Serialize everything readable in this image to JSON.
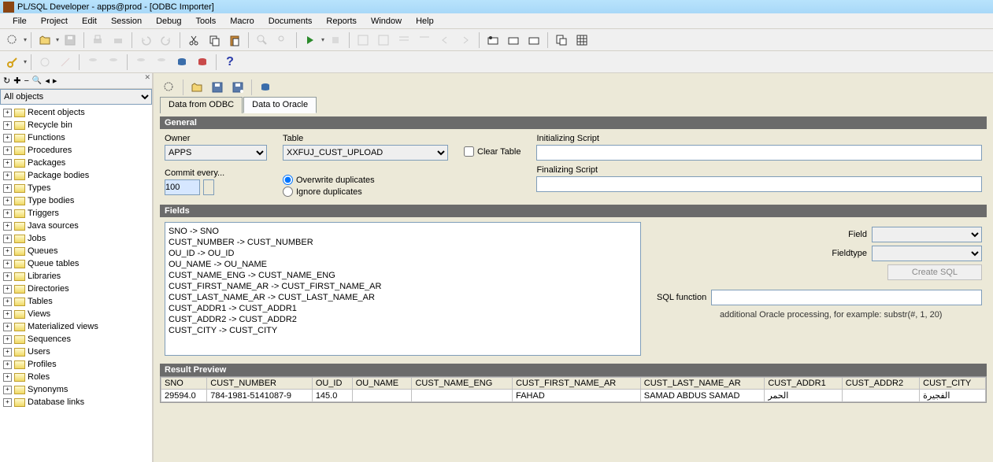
{
  "title": "PL/SQL Developer - apps@prod - [ODBC Importer]",
  "menu": [
    "File",
    "Project",
    "Edit",
    "Session",
    "Debug",
    "Tools",
    "Macro",
    "Documents",
    "Reports",
    "Window",
    "Help"
  ],
  "sidebar": {
    "filter": "All objects",
    "items": [
      "Recent objects",
      "Recycle bin",
      "Functions",
      "Procedures",
      "Packages",
      "Package bodies",
      "Types",
      "Type bodies",
      "Triggers",
      "Java sources",
      "Jobs",
      "Queues",
      "Queue tables",
      "Libraries",
      "Directories",
      "Tables",
      "Views",
      "Materialized views",
      "Sequences",
      "Users",
      "Profiles",
      "Roles",
      "Synonyms",
      "Database links"
    ]
  },
  "tabs": {
    "odbc": "Data from ODBC",
    "oracle": "Data to Oracle"
  },
  "sections": {
    "general": "General",
    "fields": "Fields",
    "preview": "Result Preview"
  },
  "general": {
    "owner_label": "Owner",
    "owner_value": "APPS",
    "table_label": "Table",
    "table_value": "XXFUJ_CUST_UPLOAD",
    "clear_table_label": "Clear Table",
    "commit_label": "Commit every...",
    "commit_value": "100",
    "overwrite_label": "Overwrite duplicates",
    "ignore_label": "Ignore duplicates",
    "init_script_label": "Initializing Script",
    "final_script_label": "Finalizing Script"
  },
  "fields": {
    "mappings": [
      "SNO -> SNO",
      "CUST_NUMBER -> CUST_NUMBER",
      "OU_ID -> OU_ID",
      "OU_NAME -> OU_NAME",
      "CUST_NAME_ENG -> CUST_NAME_ENG",
      "CUST_FIRST_NAME_AR -> CUST_FIRST_NAME_AR",
      "CUST_LAST_NAME_AR -> CUST_LAST_NAME_AR",
      "CUST_ADDR1 -> CUST_ADDR1",
      "CUST_ADDR2 -> CUST_ADDR2",
      "CUST_CITY -> CUST_CITY"
    ],
    "field_label": "Field",
    "fieldtype_label": "Fieldtype",
    "create_sql_label": "Create SQL",
    "sql_function_label": "SQL function",
    "hint": "additional Oracle processing, for example: substr(#, 1, 20)"
  },
  "preview": {
    "headers": [
      "SNO",
      "CUST_NUMBER",
      "OU_ID",
      "OU_NAME",
      "CUST_NAME_ENG",
      "CUST_FIRST_NAME_AR",
      "CUST_LAST_NAME_AR",
      "CUST_ADDR1",
      "CUST_ADDR2",
      "CUST_CITY"
    ],
    "rows": [
      [
        "29594.0",
        "784-1981-5141087-9",
        "145.0",
        "",
        "",
        "FAHAD",
        "SAMAD ABDUS SAMAD",
        "الحمر",
        "",
        "الفجيرة"
      ]
    ]
  }
}
